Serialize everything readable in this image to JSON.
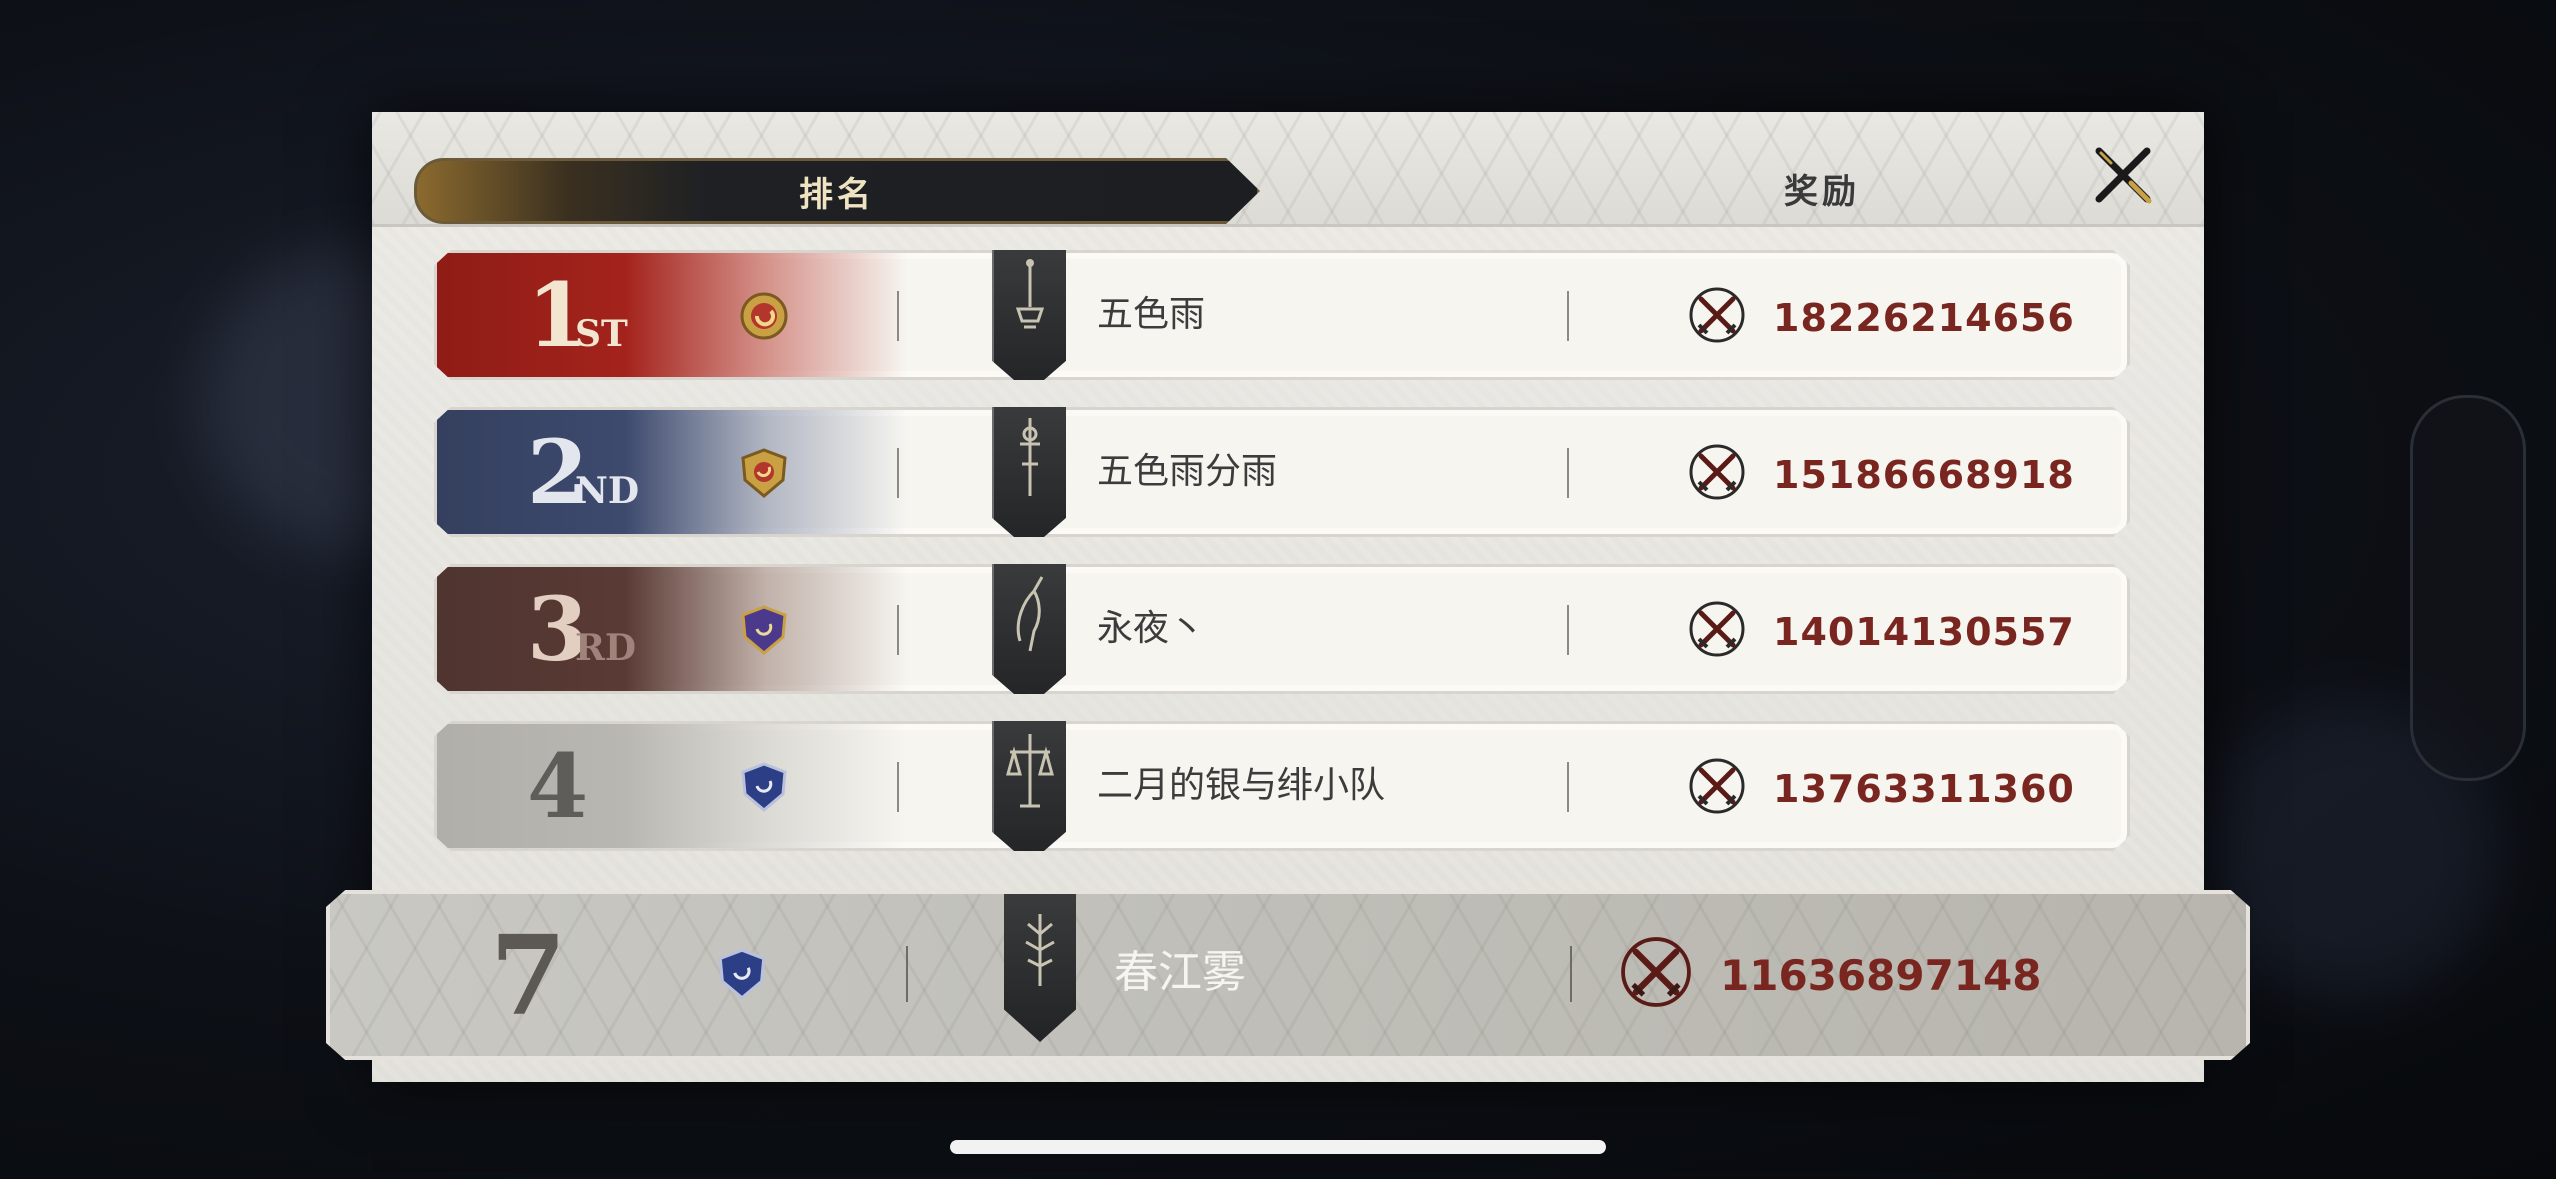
{
  "tabs": {
    "ranking": "排名",
    "reward": "奖励"
  },
  "rows": [
    {
      "rank": "1",
      "suffix": "ST",
      "name": "五色雨",
      "score": "18226214656"
    },
    {
      "rank": "2",
      "suffix": "ND",
      "name": "五色雨分雨",
      "score": "15186668918"
    },
    {
      "rank": "3",
      "suffix": "RD",
      "name": "永夜丶",
      "score": "14014130557"
    },
    {
      "rank": "4",
      "suffix": "",
      "name": "二月的银与绯小队",
      "score": "13763311360"
    }
  ],
  "self": {
    "rank": "7",
    "name": "春江雾",
    "score": "11636897148"
  },
  "colors": {
    "gold": "#c9a043",
    "rank1": "#a3231c",
    "rank2": "#3d4a6e",
    "rank3": "#5a3a34",
    "rank4": "#b8b7b1",
    "score": "#7a2620"
  }
}
